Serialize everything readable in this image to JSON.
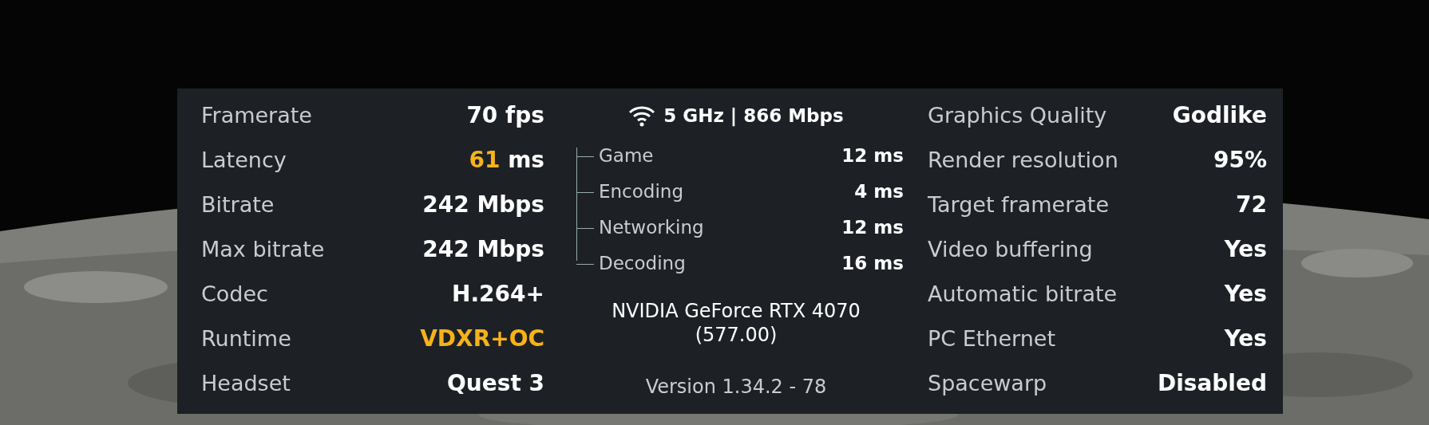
{
  "left_stats": [
    {
      "label": "Framerate",
      "value": "70 fps",
      "highlight": false
    },
    {
      "label": "Latency",
      "value": "61",
      "unit": "ms",
      "highlight": true
    },
    {
      "label": "Bitrate",
      "value": "242 Mbps",
      "highlight": false
    },
    {
      "label": "Max bitrate",
      "value": "242 Mbps",
      "highlight": false
    },
    {
      "label": "Codec",
      "value": "H.264+",
      "highlight": false
    },
    {
      "label": "Runtime",
      "value": "VDXR+OC",
      "highlight": true
    },
    {
      "label": "Headset",
      "value": "Quest 3",
      "highlight": false
    }
  ],
  "network": {
    "connection": "5 GHz | 866 Mbps",
    "breakdown": [
      {
        "label": "Game",
        "value": "12 ms"
      },
      {
        "label": "Encoding",
        "value": "4 ms"
      },
      {
        "label": "Networking",
        "value": "12 ms"
      },
      {
        "label": "Decoding",
        "value": "16 ms"
      }
    ],
    "gpu": "NVIDIA GeForce RTX 4070 (577.00)",
    "version": "Version 1.34.2 - 78"
  },
  "right_stats": [
    {
      "label": "Graphics Quality",
      "value": "Godlike"
    },
    {
      "label": "Render resolution",
      "value": "95%"
    },
    {
      "label": "Target framerate",
      "value": "72"
    },
    {
      "label": "Video buffering",
      "value": "Yes"
    },
    {
      "label": "Automatic bitrate",
      "value": "Yes"
    },
    {
      "label": "PC Ethernet",
      "value": "Yes"
    },
    {
      "label": "Spacewarp",
      "value": "Disabled"
    }
  ]
}
